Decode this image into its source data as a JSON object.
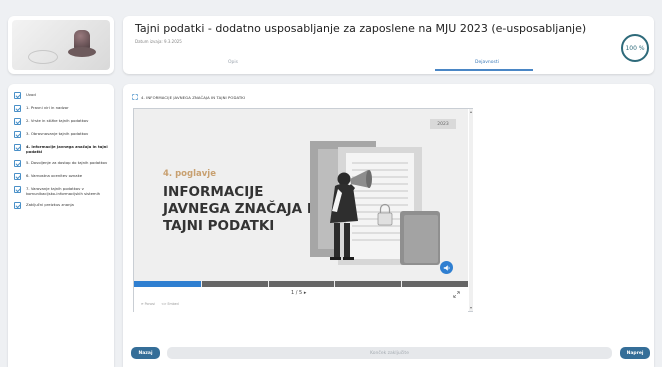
{
  "header": {
    "title": "Tajni podatki - dodatno usposabljanje za zaposlene na MJU 2023 (e-usposabljanje)",
    "date": "Datum izvaja: 9.3.2025",
    "tabs": [
      {
        "label": "Opis",
        "active": false
      },
      {
        "label": "Dejavnosti",
        "active": true
      }
    ],
    "progress": "100 %",
    "progress_value": 100
  },
  "sidebar": {
    "items": [
      {
        "label": "Uvod",
        "checked": true,
        "active": false
      },
      {
        "label": "1. Pravni viri in nadzor",
        "checked": true,
        "active": false
      },
      {
        "label": "2. Vrste in stižke tajnih podatkov",
        "checked": true,
        "active": false
      },
      {
        "label": "3. Obravnavanje tajnih podatkov",
        "checked": true,
        "active": false
      },
      {
        "label": "4. Informacije javnega značaja in tajni podatki",
        "checked": true,
        "active": true
      },
      {
        "label": "5. Dovoljenje za dostop do tajnih podatkov",
        "checked": true,
        "active": false
      },
      {
        "label": "6. Varnostna ocenitev oznake",
        "checked": true,
        "active": false
      },
      {
        "label": "7. Varovanje tajnih podatkov v komunikacijsko-informacijskih sistemih",
        "checked": true,
        "active": false
      },
      {
        "label": "Zaključni preizkus znanja",
        "checked": true,
        "active": false
      }
    ]
  },
  "main": {
    "section_title": "4. INFORMACIJE JAVNEGA ZNAČAJA IN TAJNI PODATKI",
    "slide": {
      "year": "2023",
      "chapter": "4. poglavje",
      "heading": "INFORMACIJE JAVNEGA ZNAČAJA IN TAJNI PODATKI"
    },
    "player": {
      "page_indicator": "1 / 5 ▸",
      "current_page": 1,
      "total_pages": 5,
      "controls_left": "⟳ Ponovi",
      "controls_right": "<> Embed"
    }
  },
  "footer": {
    "back_label": "Nazaj",
    "finish_label": "Konček zaključite",
    "next_label": "Naprej"
  },
  "colors": {
    "accent": "#356e98",
    "progress_ring": "#2e6a7a",
    "player_blue": "#2f7fd1",
    "chapter_tan": "#c8a070"
  }
}
